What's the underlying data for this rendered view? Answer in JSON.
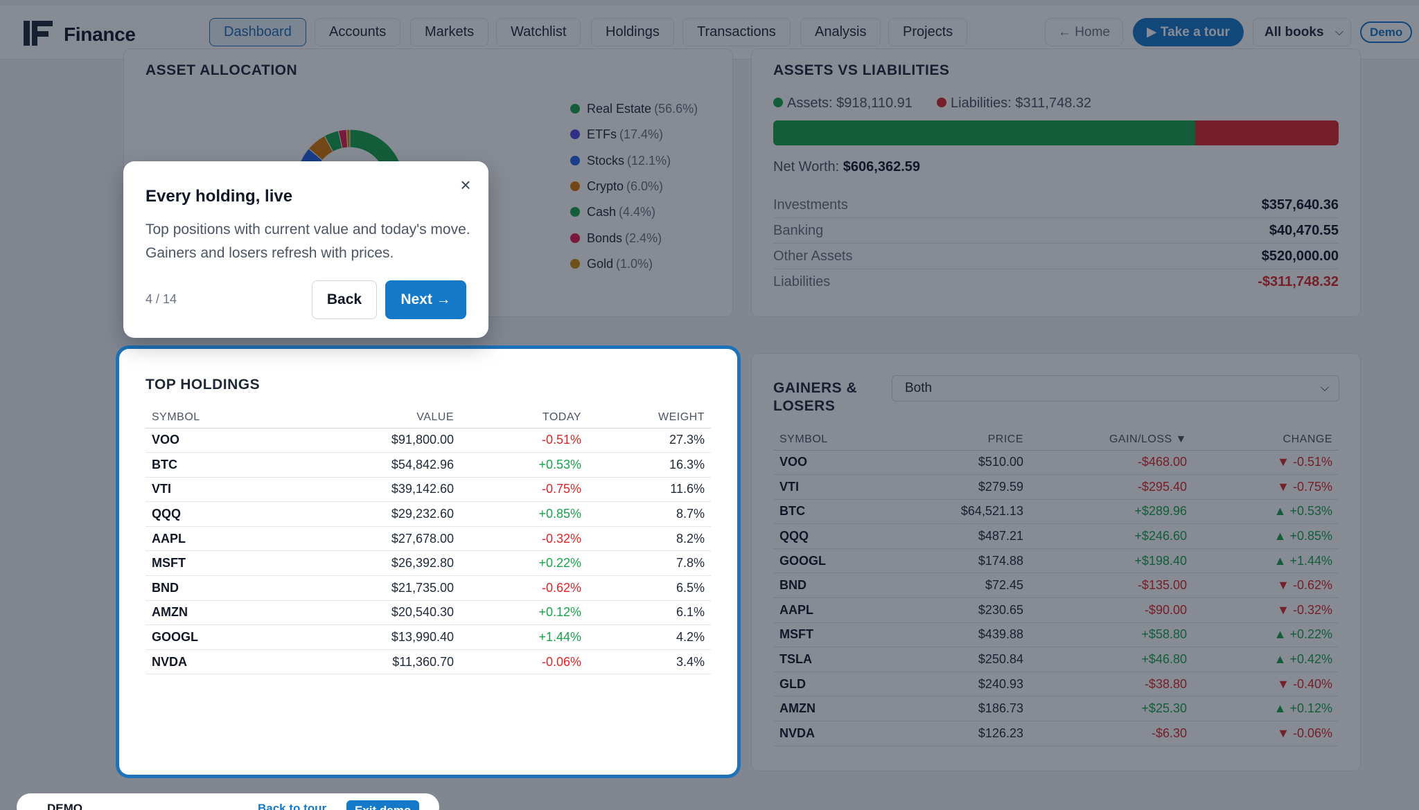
{
  "nav": {
    "brand": "Finance",
    "tabs": [
      "Dashboard",
      "Accounts",
      "Markets",
      "Watchlist",
      "Holdings",
      "Transactions",
      "Analysis",
      "Projects"
    ],
    "home_label": "← Home",
    "tour_label": "▶ Take a tour",
    "books_label": "All books",
    "demo_label": "Demo"
  },
  "allocation": {
    "title": "ASSET ALLOCATION",
    "items": [
      {
        "label": "Real Estate",
        "pct": "(56.6%)",
        "value": 56.6,
        "color": "#16a34a"
      },
      {
        "label": "ETFs",
        "pct": "(17.4%)",
        "value": 17.4,
        "color": "#4f46e5"
      },
      {
        "label": "Stocks",
        "pct": "(12.1%)",
        "value": 12.1,
        "color": "#2563eb"
      },
      {
        "label": "Crypto",
        "pct": "(6.0%)",
        "value": 6.0,
        "color": "#d97706"
      },
      {
        "label": "Cash",
        "pct": "(4.4%)",
        "value": 4.4,
        "color": "#15a34a"
      },
      {
        "label": "Bonds",
        "pct": "(2.4%)",
        "value": 2.4,
        "color": "#e11d48"
      },
      {
        "label": "Gold",
        "pct": "(1.0%)",
        "value": 1.0,
        "color": "#ca8a04"
      }
    ]
  },
  "assets_liabilities": {
    "title": "ASSETS VS LIABILITIES",
    "assets_label": "Assets: $918,110.91",
    "liabilities_label": "Liabilities: $311,748.32",
    "assets_value": 918110.91,
    "liabilities_value": 311748.32,
    "assets_color": "#16a34a",
    "liabilities_color": "#dc2626",
    "net_worth_label": "Net Worth:",
    "net_worth_value": "$606,362.59",
    "rows": [
      {
        "label": "Investments",
        "value": "$357,640.36"
      },
      {
        "label": "Banking",
        "value": "$40,470.55"
      },
      {
        "label": "Other Assets",
        "value": "$520,000.00"
      },
      {
        "label": "Liabilities",
        "value": "-$311,748.32"
      }
    ]
  },
  "top_holdings": {
    "title": "TOP HOLDINGS",
    "headers": [
      "SYMBOL",
      "VALUE",
      "TODAY",
      "WEIGHT"
    ],
    "rows": [
      {
        "symbol": "VOO",
        "value": "$91,800.00",
        "today": "-0.51%",
        "weight": "27.3%"
      },
      {
        "symbol": "BTC",
        "value": "$54,842.96",
        "today": "+0.53%",
        "weight": "16.3%"
      },
      {
        "symbol": "VTI",
        "value": "$39,142.60",
        "today": "-0.75%",
        "weight": "11.6%"
      },
      {
        "symbol": "QQQ",
        "value": "$29,232.60",
        "today": "+0.85%",
        "weight": "8.7%"
      },
      {
        "symbol": "AAPL",
        "value": "$27,678.00",
        "today": "-0.32%",
        "weight": "8.2%"
      },
      {
        "symbol": "MSFT",
        "value": "$26,392.80",
        "today": "+0.22%",
        "weight": "7.8%"
      },
      {
        "symbol": "BND",
        "value": "$21,735.00",
        "today": "-0.62%",
        "weight": "6.5%"
      },
      {
        "symbol": "AMZN",
        "value": "$20,540.30",
        "today": "+0.12%",
        "weight": "6.1%"
      },
      {
        "symbol": "GOOGL",
        "value": "$13,990.40",
        "today": "+1.44%",
        "weight": "4.2%"
      },
      {
        "symbol": "NVDA",
        "value": "$11,360.70",
        "today": "-0.06%",
        "weight": "3.4%"
      }
    ]
  },
  "gainers_losers": {
    "title": "GAINERS & LOSERS",
    "filter_value": "Both",
    "headers": [
      "SYMBOL",
      "PRICE",
      "GAIN/LOSS ▼",
      "CHANGE"
    ],
    "rows": [
      {
        "symbol": "VOO",
        "price": "$510.00",
        "gain": "-$468.00",
        "change": "▼ -0.51%"
      },
      {
        "symbol": "VTI",
        "price": "$279.59",
        "gain": "-$295.40",
        "change": "▼ -0.75%"
      },
      {
        "symbol": "BTC",
        "price": "$64,521.13",
        "gain": "+$289.96",
        "change": "▲ +0.53%"
      },
      {
        "symbol": "QQQ",
        "price": "$487.21",
        "gain": "+$246.60",
        "change": "▲ +0.85%"
      },
      {
        "symbol": "GOOGL",
        "price": "$174.88",
        "gain": "+$198.40",
        "change": "▲ +1.44%"
      },
      {
        "symbol": "BND",
        "price": "$72.45",
        "gain": "-$135.00",
        "change": "▼ -0.62%"
      },
      {
        "symbol": "AAPL",
        "price": "$230.65",
        "gain": "-$90.00",
        "change": "▼ -0.32%"
      },
      {
        "symbol": "MSFT",
        "price": "$439.88",
        "gain": "+$58.80",
        "change": "▲ +0.22%"
      },
      {
        "symbol": "TSLA",
        "price": "$250.84",
        "gain": "+$46.80",
        "change": "▲ +0.42%"
      },
      {
        "symbol": "GLD",
        "price": "$240.93",
        "gain": "-$38.80",
        "change": "▼ -0.40%"
      },
      {
        "symbol": "AMZN",
        "price": "$186.73",
        "gain": "+$25.30",
        "change": "▲ +0.12%"
      },
      {
        "symbol": "NVDA",
        "price": "$126.23",
        "gain": "-$6.30",
        "change": "▼ -0.06%"
      }
    ]
  },
  "tour": {
    "title": "Every holding, live",
    "body": "Top positions with current value and today's move. Gainers and losers refresh with prices.",
    "step": "4 / 14",
    "back_label": "Back",
    "next_label": "Next →",
    "close_label": "×"
  },
  "demo_bar": {
    "text": "DEMO",
    "link": "Back to tour",
    "exit": "Exit demo"
  },
  "colors": {
    "accent": "#1479c9",
    "positive": "#16a34a",
    "negative": "#dc2626"
  }
}
